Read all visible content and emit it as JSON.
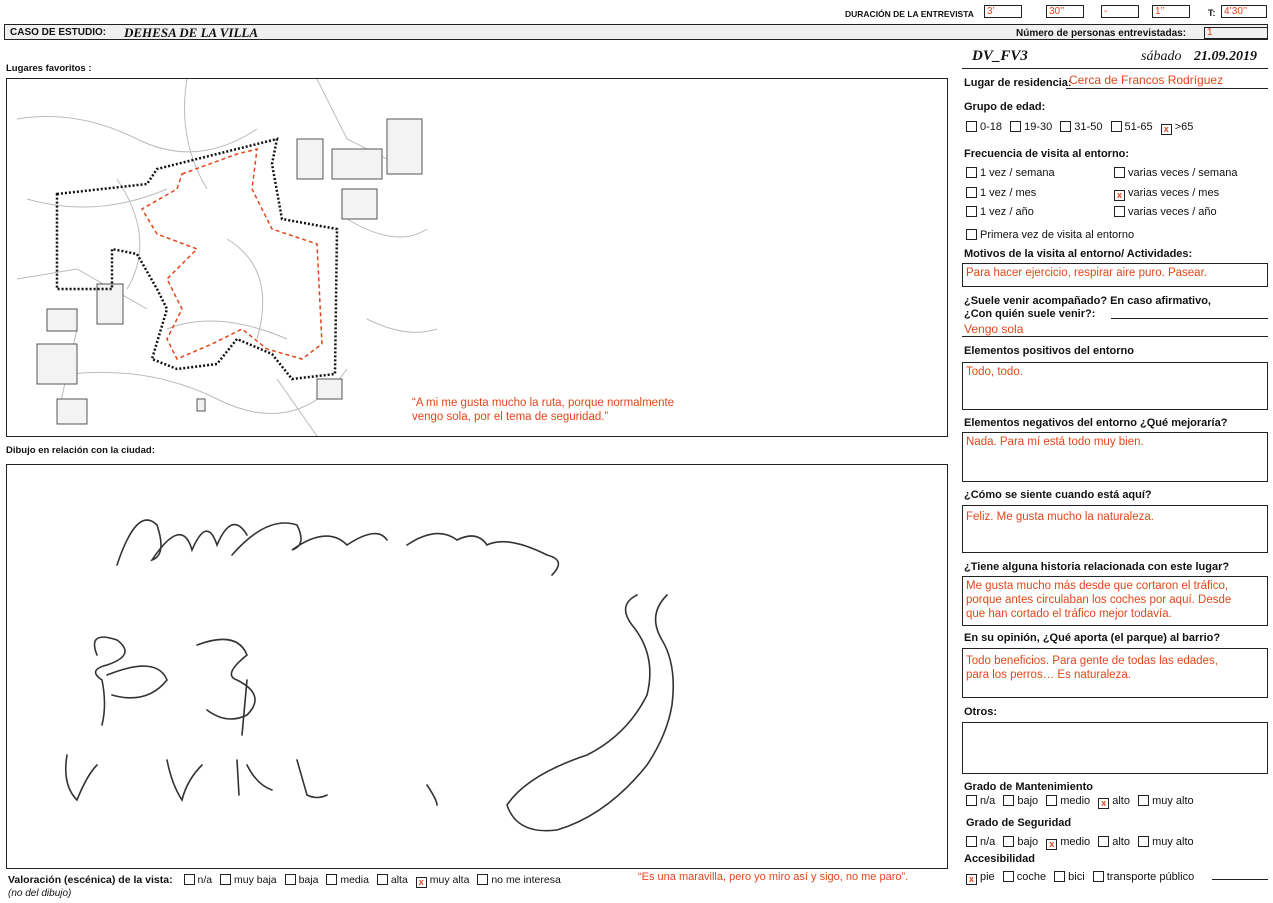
{
  "header": {
    "duration_label": "DURACIÓN DE LA ENTREVISTA",
    "dur1": "3’",
    "dur2": "30’’",
    "dur3": "-",
    "dur4": "1’’",
    "t_label": "T:",
    "total": "4’30’’",
    "case_label": "CASO DE ESTUDIO:",
    "case_name": "DEHESA DE LA VILLA",
    "persons_label": "Número de personas entrevistadas:",
    "persons_value": "1"
  },
  "left": {
    "favorites_label": "Lugares favoritos :",
    "map_quote_1": "“A mi me gusta mucho la ruta, porque normalmente",
    "map_quote_2": "vengo sola, por el tema de seguridad.”",
    "drawing_label": "Dibujo en relación con la ciudad:",
    "valuation_label": "Valoración (escénica) de la vista:",
    "valuation_options": [
      "n/a",
      "muy baja",
      "baja",
      "media",
      "alta",
      "muy alta",
      "no me interesa"
    ],
    "valuation_quote": "“Es una maravilla, pero yo miro así y sigo, no me paro”.",
    "valuation_note": "(no del dibujo)"
  },
  "right": {
    "code": "DV_FV3",
    "date_day": "sábado",
    "date": "21.09.2019",
    "residence_label": "Lugar de residencia:",
    "residence_value": "Cerca de Francos Rodríguez",
    "age_label": "Grupo de edad:",
    "age_options": [
      "0-18",
      "19-30",
      "31-50",
      "51-65",
      ">65"
    ],
    "freq_label": "Frecuencia de visita al entorno:",
    "freq_options": [
      "1 vez / semana",
      "varias veces / semana",
      "1 vez / mes",
      "varias veces / mes",
      "1 vez / año",
      "varias veces / año",
      "Primera vez de visita al entorno"
    ],
    "motives_label": "Motivos de la visita al entorno/ Actividades:",
    "motives_value": "Para hacer ejercicio, respirar aire puro. Pasear.",
    "company_label_1": "¿Suele venir acompañado? En caso afirmativo,",
    "company_label_2": "¿Con quién suele venir?:",
    "company_value": "Vengo sola",
    "positive_label": "Elementos positivos del entorno",
    "positive_value": "Todo, todo.",
    "negative_label": "Elementos negativos del entorno  ¿Qué mejoraría?",
    "negative_value": "Nada. Para mí está todo muy bien.",
    "feel_label": "¿Cómo se siente cuando está aquí?",
    "feel_value": "Feliz. Me gusta mucho la naturaleza.",
    "story_label": "¿Tiene alguna historia relacionada con este lugar?",
    "story_value_1": "Me gusta mucho más desde que cortaron el tráfico,",
    "story_value_2": "porque antes circulaban los coches por aquí. Desde",
    "story_value_3": "que han cortado el tráfico mejor todavía.",
    "contrib_label": "En su opinión, ¿Qué aporta (el parque) al barrio?",
    "contrib_value_1": "Todo beneficios. Para gente de todas las edades,",
    "contrib_value_2": "para los perros… Es naturaleza.",
    "others_label": "Otros:",
    "maint_label": "Grado de Mantenimiento",
    "level_options": [
      "n/a",
      "bajo",
      "medio",
      "alto",
      "muy alto"
    ],
    "security_label": "Grado de Seguridad",
    "access_label": "Accesibilidad",
    "access_options": [
      "pie",
      "coche",
      "bici",
      "transporte público"
    ],
    "check_mark": "x"
  }
}
